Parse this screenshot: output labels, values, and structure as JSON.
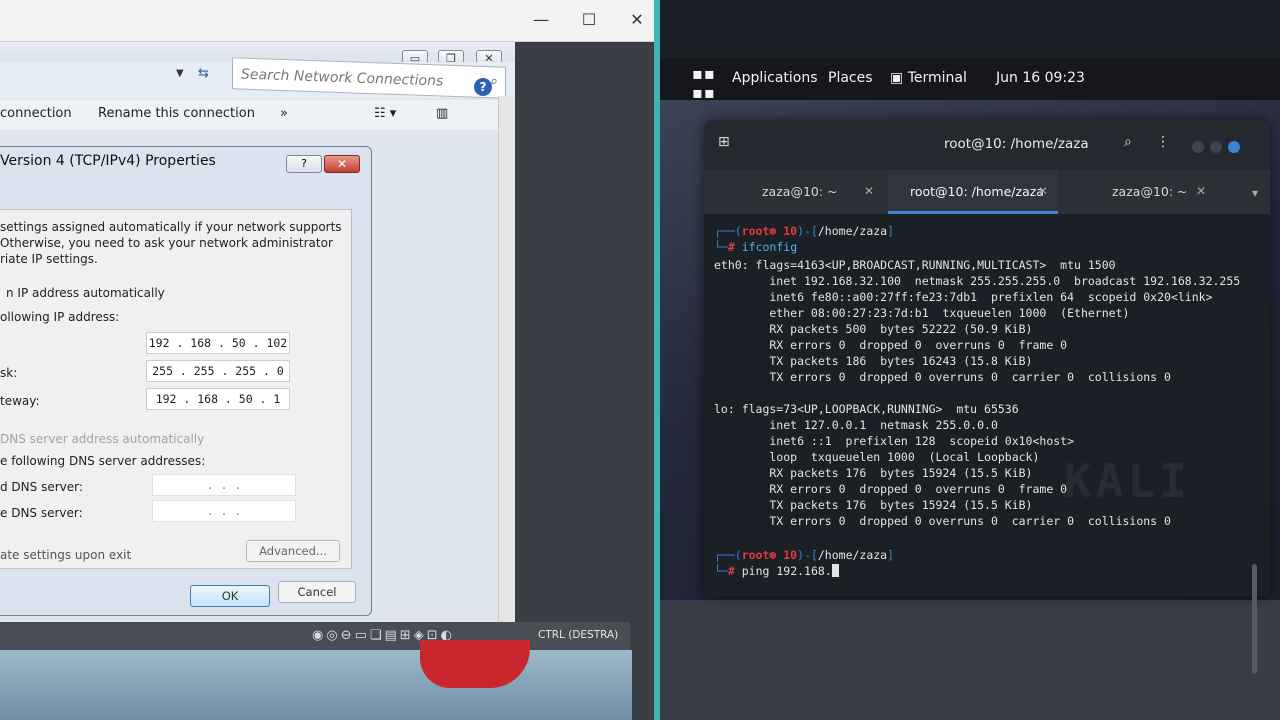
{
  "left": {
    "search": {
      "placeholder": "Search Network Connections"
    },
    "toolbar": {
      "item1": "connection",
      "item2": "Rename this connection",
      "more": "»"
    },
    "host_window": {
      "minimize": "—",
      "maximize": "☐",
      "close": "✕"
    },
    "net_window": {
      "minimize": "▭",
      "restore": "❐",
      "close": "✕"
    },
    "tcp_dialog": {
      "title": "Version 4 (TCP/IPv4) Properties",
      "help": "?",
      "close": "✕",
      "intro1": "settings assigned automatically if your network supports",
      "intro2": "Otherwise, you need to ask your network administrator",
      "intro3": "riate IP settings.",
      "auto_ip": "n IP address automatically",
      "use_ip": "ollowing IP address:",
      "ip_label": "",
      "ip_value": "192 . 168 . 50 . 102",
      "mask_label": "sk:",
      "mask_value": "255 . 255 . 255 . 0",
      "gw_label": "teway:",
      "gw_value": "192 . 168 . 50 . 1",
      "auto_dns": "DNS server address automatically",
      "use_dns": "e following DNS server addresses:",
      "pref_dns_label": "d DNS server:",
      "pref_dns_value": ".        .        .",
      "alt_dns_label": "e DNS server:",
      "alt_dns_value": ".        .        .",
      "validate": "ate settings upon exit",
      "advanced": "Advanced...",
      "ok": "OK",
      "cancel": "Cancel"
    },
    "vm_status": {
      "hostkey": "CTRL (DESTRA)"
    }
  },
  "right": {
    "topbar": {
      "applications": "Applications",
      "places": "Places",
      "terminal": "Terminal",
      "datetime": "Jun 16  09:23"
    },
    "terminal": {
      "title": "root@10: /home/zaza",
      "tabs": [
        {
          "label": "zaza@10: ~"
        },
        {
          "label": "root@10: /home/zaza"
        },
        {
          "label": "zaza@10: ~"
        }
      ],
      "prompt_user": "root⊛ 10",
      "prompt_path": "/home/zaza",
      "cmd1": "ifconfig",
      "lines": [
        "eth0: flags=4163<UP,BROADCAST,RUNNING,MULTICAST>  mtu 1500",
        "        inet 192.168.32.100  netmask 255.255.255.0  broadcast 192.168.32.255",
        "        inet6 fe80::a00:27ff:fe23:7db1  prefixlen 64  scopeid 0x20<link>",
        "        ether 08:00:27:23:7d:b1  txqueuelen 1000  (Ethernet)",
        "        RX packets 500  bytes 52222 (50.9 KiB)",
        "        RX errors 0  dropped 0  overruns 0  frame 0",
        "        TX packets 186  bytes 16243 (15.8 KiB)",
        "        TX errors 0  dropped 0 overruns 0  carrier 0  collisions 0",
        "",
        "lo: flags=73<UP,LOOPBACK,RUNNING>  mtu 65536",
        "        inet 127.0.0.1  netmask 255.0.0.0",
        "        inet6 ::1  prefixlen 128  scopeid 0x10<host>",
        "        loop  txqueuelen 1000  (Local Loopback)",
        "        RX packets 176  bytes 15924 (15.5 KiB)",
        "        RX errors 0  dropped 0  overruns 0  frame 0",
        "        TX packets 176  bytes 15924 (15.5 KiB)",
        "        TX errors 0  dropped 0 overruns 0  carrier 0  collisions 0"
      ],
      "cmd2": "ping 192.168."
    }
  }
}
